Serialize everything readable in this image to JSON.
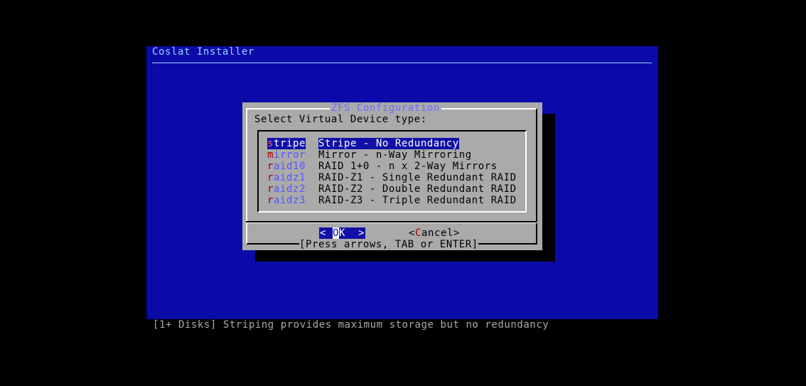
{
  "backtitle": "Coslat Installer",
  "dialog": {
    "title": "ZFS Configuration",
    "prompt": "Select Virtual Device type:",
    "items": [
      {
        "tag_hot": "s",
        "tag_rest": "tripe",
        "desc": "Stripe - No Redundancy",
        "selected": true
      },
      {
        "tag_hot": "m",
        "tag_rest": "irror",
        "desc": "Mirror - n-Way Mirroring",
        "selected": false
      },
      {
        "tag_hot": "r",
        "tag_rest": "aid10",
        "desc": "RAID 1+0 - n x 2-Way Mirrors",
        "selected": false
      },
      {
        "tag_hot": "r",
        "tag_rest": "aidz1",
        "desc": "RAID-Z1 - Single Redundant RAID",
        "selected": false
      },
      {
        "tag_hot": "r",
        "tag_rest": "aidz2",
        "desc": "RAID-Z2 - Double Redundant RAID",
        "selected": false
      },
      {
        "tag_hot": "r",
        "tag_rest": "aidz3",
        "desc": "RAID-Z3 - Triple Redundant RAID",
        "selected": false
      }
    ],
    "ok_button": {
      "left": "< ",
      "hot": "O",
      "rest": "K  >"
    },
    "cancel_button": {
      "left": "<",
      "hot": "C",
      "rest": "ancel>"
    },
    "hint": "[Press arrows, TAB or ENTER]"
  },
  "helpline": "[1+ Disks] Striping provides maximum storage but no redundancy",
  "colors": {
    "screen_bg": "#0a0aa8",
    "dialog_bg": "#aaaaaa",
    "selection_bg": "#1010a8",
    "hotkey": "#a80000",
    "title": "#6b6bff"
  }
}
